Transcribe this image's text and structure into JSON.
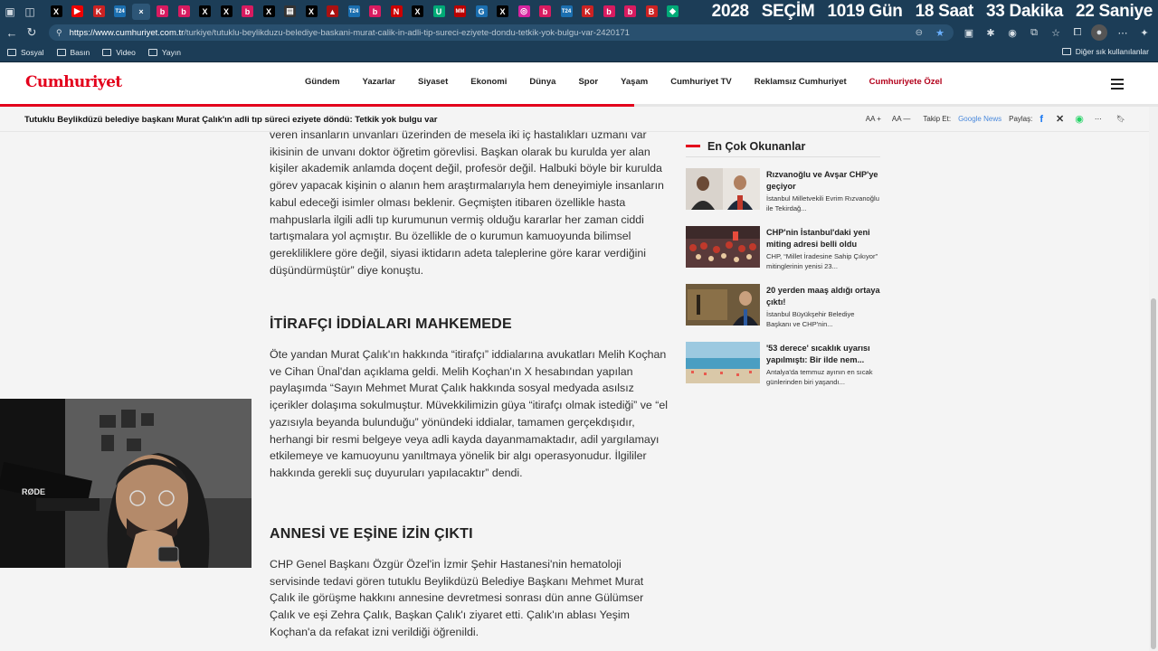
{
  "browser": {
    "url_host": "https://www.cumhuriyet.com.tr",
    "url_path": "/turkiye/tutuklu-beylikduzu-belediye-baskani-murat-calik-in-adli-tip-sureci-eziyete-dondu-tetkik-yok-bulgu-var-2420171",
    "bookmarks": [
      "Sosyal",
      "Basın",
      "Video",
      "Yayın"
    ],
    "bookmarks_right": "Diğer sık kullanılanlar"
  },
  "countdown": {
    "year": "2028",
    "label": "SEÇİM",
    "days": "1019 Gün",
    "hours": "18 Saat",
    "minutes": "33 Dakika",
    "seconds": "22 Saniye"
  },
  "site": {
    "logo": "Cumhuriyet",
    "nav": [
      "Gündem",
      "Yazarlar",
      "Siyaset",
      "Ekonomi",
      "Dünya",
      "Spor",
      "Yaşam",
      "Cumhuriyet TV",
      "Reklamsız Cumhuriyet",
      "Cumhuriyete Özel"
    ],
    "article_title": "Tutuklu Beylikdüzü belediye başkanı Murat Çalık'ın adli tıp süreci eziyete döndü: Tetkik yok bulgu var",
    "reading_progress": 0.548,
    "tools": {
      "font_up": "A",
      "font_down": "A",
      "follow": "Takip Et:",
      "google_news": "Google News",
      "share": "Paylaş:"
    },
    "colors": {
      "brand_red": "#e3001b",
      "special": "#b3001b",
      "chrome": "#1c3d57"
    }
  },
  "article": {
    "p1": "veren insanların unvanları üzerinden de mesela iki iç hastalıkları uzmanı var ikisinin de unvanı doktor öğretim görevlisi. Başkan olarak bu kurulda yer alan kişiler akademik anlamda doçent değil, profesör değil. Halbuki böyle bir kurulda görev yapacak kişinin o alanın hem araştırmalarıyla hem deneyimiyle insanların kabul edeceği isimler olması beklenir. Geçmişten itibaren özellikle hasta mahpuslarla ilgili adli tıp kurumunun vermiş olduğu kararlar her zaman ciddi tartışmalara yol açmıştır. Bu özellikle de o kurumun kamuoyunda bilimsel gerekliliklere göre değil, siyasi iktidarın adeta taleplerine göre karar verdiğini düşündürmüştür” diye konuştu.",
    "h1": "İTİRAFÇI İDDİALARI MAHKEMEDE",
    "p2": "Öte yandan Murat Çalık'ın hakkında “itirafçı” iddialarına avukatları Melih Koçhan ve Cihan Ünal'dan açıklama geldi. Melih Koçhan'ın X hesabından yapılan paylaşımda “Sayın Mehmet Murat Çalık hakkında sosyal medyada asılsız içerikler dolaşıma sokulmuştur. Müvekkilimizin güya “itirafçı olmak istediği” ve “el yazısıyla beyanda bulunduğu” yönündeki iddialar, tamamen gerçekdışıdır, herhangi bir resmi belgeye veya adli kayda dayanmamaktadır, adil yargılamayı etkilemeye ve kamuoyunu yanıltmaya yönelik bir algı operasyonudur. İlgililer hakkında gerekli suç duyuruları yapılacaktır” dendi.",
    "h2": "ANNESİ VE EŞİNE İZİN ÇIKTI",
    "p3": "CHP Genel Başkanı Özgür Özel'in İzmir Şehir Hastanesi'nin hematoloji servisinde tedavi gören tutuklu Beylikdüzü Belediye Başkanı Mehmet Murat Çalık ile görüşme hakkını annesine devretmesi sonrası dün anne Gülümser Çalık ve eşi Zehra Çalık, Başkan Çalık'ı ziyaret etti. Çalık'ın ablası Yeşim Koçhan'a da refakat izni verildiği öğrenildi."
  },
  "sidebar": {
    "heading": "En Çok Okunanlar",
    "items": [
      {
        "title": "Rızvanoğlu ve Avşar CHP'ye geçiyor",
        "summary": "İstanbul Milletvekili Evrim Rızvanoğlu ile Tekirdağ..."
      },
      {
        "title": "CHP'nin İstanbul'daki yeni miting adresi belli oldu",
        "summary": "CHP, “Millet İradesine Sahip Çıkıyor” mitinglerinin yenisi 23..."
      },
      {
        "title": "20 yerden maaş aldığı ortaya çıktı!",
        "summary": "İstanbul Büyükşehir Belediye Başkanı ve CHP'nin..."
      },
      {
        "title": "'53 derece' sıcaklık uyarısı yapılmıştı: Bir ilde nem...",
        "summary": "Antalya'da temmuz ayının en sıcak günlerinden biri yaşandı..."
      }
    ]
  },
  "webcam": {
    "mic_label": "RØDE"
  }
}
